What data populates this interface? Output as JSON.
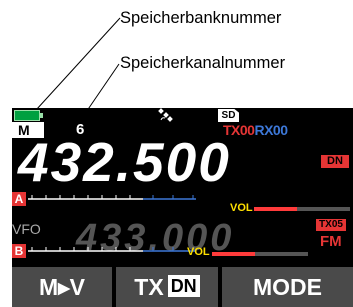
{
  "callouts": {
    "bank_number": "Speicherbanknummer",
    "channel_number": "Speicherkanalnummer"
  },
  "status": {
    "battery": "battery-icon",
    "gps": "gps-satellite-icon",
    "sd": "SD"
  },
  "memory": {
    "bank": "M",
    "channel": "6"
  },
  "txrx": {
    "tx": "TX00",
    "rx": "RX00"
  },
  "band_a": {
    "label": "A",
    "frequency": "432.500",
    "mode_badge": "DN",
    "vol_label": "VOL",
    "vol_level": 0.45
  },
  "band_b": {
    "mode_label": "VFO",
    "label": "B",
    "frequency": "433.000",
    "tx_badge": "TX05",
    "mode": "FM",
    "vol_label": "VOL",
    "vol_level": 0.45
  },
  "softkeys": {
    "mv": "M▸V",
    "txdn_tx": "TX",
    "txdn_dn": "DN",
    "mode": "MODE"
  },
  "colors": {
    "accent_red": "#e53535",
    "rx_blue": "#3d78d8",
    "vol_yellow": "#ffe000",
    "battery_green": "#00a040"
  }
}
